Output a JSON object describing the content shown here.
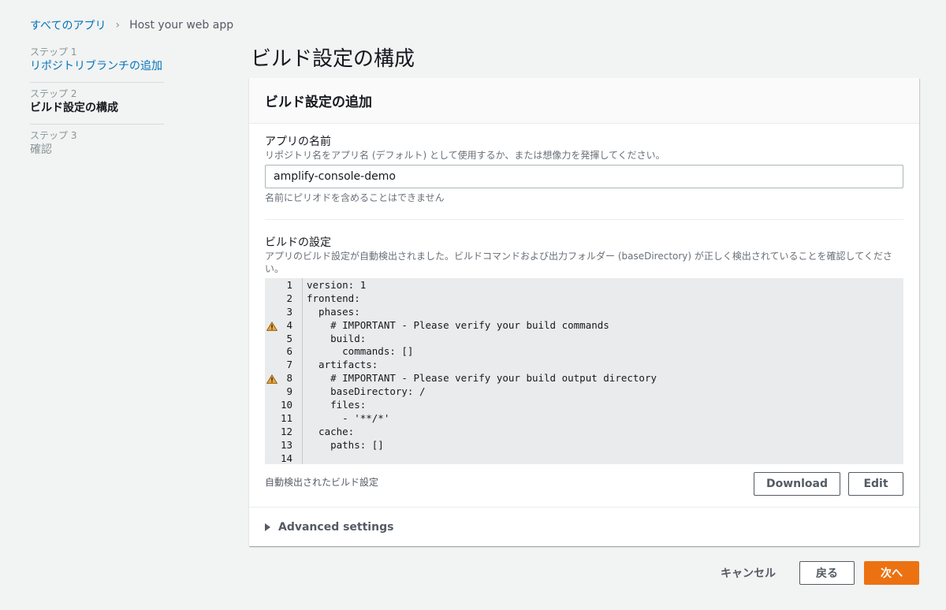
{
  "breadcrumb": {
    "root": "すべてのアプリ",
    "current": "Host your web app"
  },
  "steps": [
    {
      "num": "ステップ 1",
      "title": "リポジトリブランチの追加",
      "state": "link"
    },
    {
      "num": "ステップ 2",
      "title": "ビルド設定の構成",
      "state": "current"
    },
    {
      "num": "ステップ 3",
      "title": "確認",
      "state": "disabled"
    }
  ],
  "page": {
    "title": "ビルド設定の構成"
  },
  "panel": {
    "header": "ビルド設定の追加",
    "app_name": {
      "label": "アプリの名前",
      "description": "リポジトリ名をアプリ名 (デフォルト) として使用するか、または想像力を発揮してください。",
      "value": "amplify-console-demo",
      "constraint": "名前にピリオドを含めることはできません"
    },
    "build_settings": {
      "label": "ビルドの設定",
      "description": "アプリのビルド設定が自動検出されました。ビルドコマンドおよび出力フォルダー (baseDirectory) が正しく検出されていることを確認してください。",
      "lines": [
        {
          "n": "1",
          "text": "version: 1",
          "warn": false
        },
        {
          "n": "2",
          "text": "frontend:",
          "warn": false
        },
        {
          "n": "3",
          "text": "  phases:",
          "warn": false
        },
        {
          "n": "4",
          "text": "    # IMPORTANT - Please verify your build commands",
          "warn": true
        },
        {
          "n": "5",
          "text": "    build:",
          "warn": false
        },
        {
          "n": "6",
          "text": "      commands: []",
          "warn": false
        },
        {
          "n": "7",
          "text": "  artifacts:",
          "warn": false
        },
        {
          "n": "8",
          "text": "    # IMPORTANT - Please verify your build output directory",
          "warn": true
        },
        {
          "n": "9",
          "text": "    baseDirectory: /",
          "warn": false
        },
        {
          "n": "10",
          "text": "    files:",
          "warn": false
        },
        {
          "n": "11",
          "text": "      - '**/*'",
          "warn": false
        },
        {
          "n": "12",
          "text": "  cache:",
          "warn": false
        },
        {
          "n": "13",
          "text": "    paths: []",
          "warn": false
        },
        {
          "n": "14",
          "text": "",
          "warn": false
        }
      ],
      "caption": "自動検出されたビルド設定",
      "download_label": "Download",
      "edit_label": "Edit"
    },
    "advanced": "Advanced settings"
  },
  "actions": {
    "cancel": "キャンセル",
    "back": "戻る",
    "next": "次へ"
  },
  "colors": {
    "accent": "#ec7211",
    "link": "#0073bb",
    "warning": "#f2a33a"
  }
}
